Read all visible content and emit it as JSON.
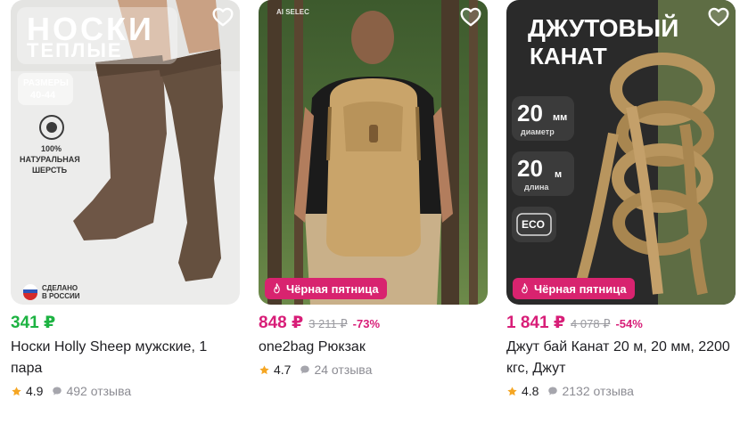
{
  "products": [
    {
      "price": "341 ₽",
      "old_price": "",
      "discount": "",
      "title": "Носки Holly Sheep мужские, 1 пара",
      "rating": "4.9",
      "reviews": "492 отзыва",
      "image": {
        "headline_1": "НОСКИ",
        "headline_2": "ТЕПЛЫЕ",
        "size_label": "РАЗМЕРЫ",
        "size_value": "40-44",
        "wool_1": "100%",
        "wool_2": "НАТУРАЛЬНАЯ",
        "wool_3": "ШЕРСТЬ",
        "made_1": "СДЕЛАНО",
        "made_2": "В РОССИИ"
      }
    },
    {
      "price": "848 ₽",
      "old_price": "3 211 ₽",
      "discount": "-73%",
      "title": "one2bag Рюкзак",
      "rating": "4.7",
      "reviews": "24 отзыва",
      "promo": "Чёрная пятница",
      "image": {
        "ai_mark": "AI SELEC"
      }
    },
    {
      "price": "1 841 ₽",
      "old_price": "4 078 ₽",
      "discount": "-54%",
      "title": "Джут бай Канат 20 м, 20 мм, 2200 кгс, Джут",
      "rating": "4.8",
      "reviews": "2132 отзыва",
      "promo": "Чёрная пятница",
      "image": {
        "headline_1": "ДЖУТОВЫЙ",
        "headline_2": "КАНАТ",
        "diam_value": "20",
        "diam_unit": "мм",
        "diam_label": "диаметр",
        "len_value": "20",
        "len_unit": "м",
        "len_label": "длина",
        "eco": "ECO"
      }
    }
  ],
  "colors": {
    "price_regular": "#1db342",
    "price_sale": "#d81e78",
    "promo_badge": "#d8236f",
    "star": "#f5a623",
    "muted": "#8c8c93"
  },
  "icons": [
    "heart-outline-icon",
    "fire-icon",
    "star-icon",
    "comment-bubble-icon"
  ]
}
